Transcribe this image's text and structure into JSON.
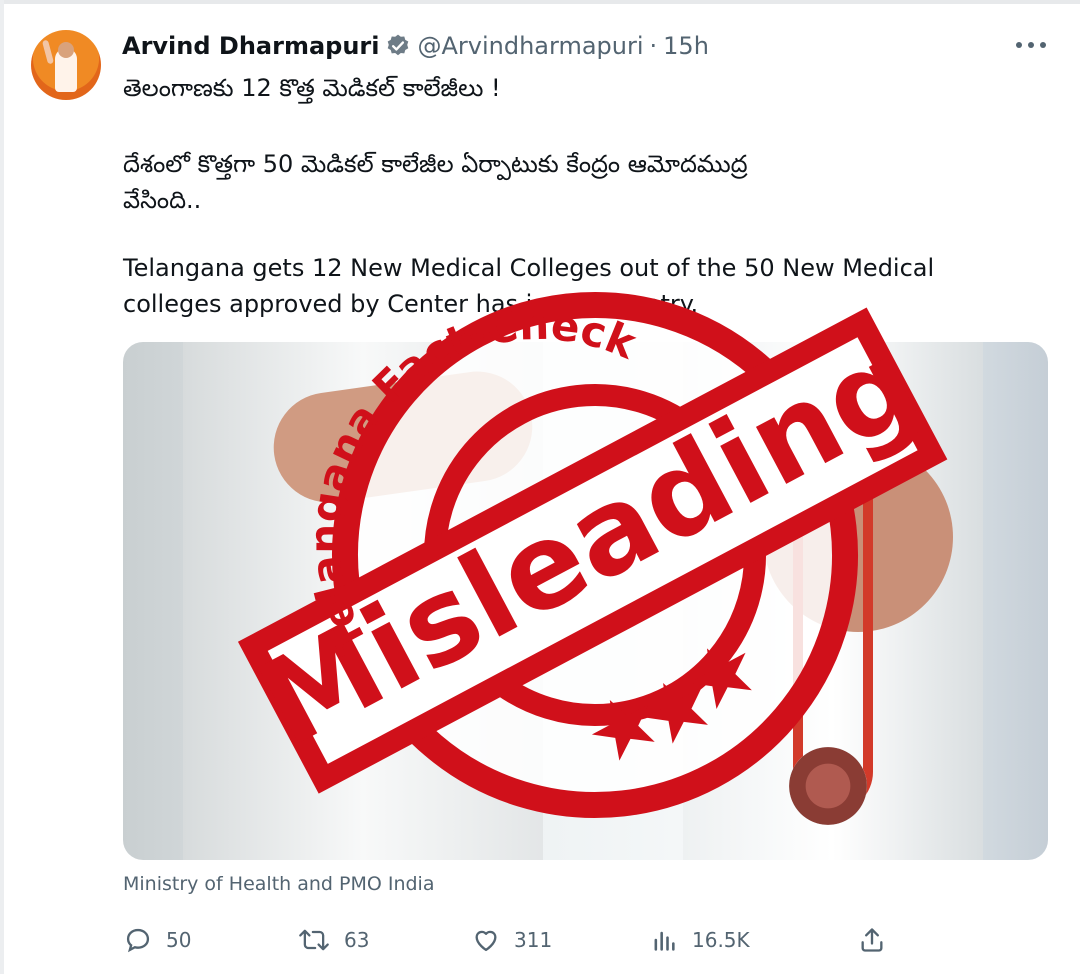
{
  "tweet": {
    "author_name": "Arvind Dharmapuri",
    "handle": "@Arvindharmapuri",
    "separator": "·",
    "time": "15h",
    "lines": [
      "తెలంగాణకు 12 కొత్త మెడికల్ కాలేజీలు !",
      "దేశంలో కొత్తగా 50 మెడికల్ కాలేజీల ఏర్పాటుకు కేంద్రం ఆమోదముద్ర",
      "వేసింది..",
      "Telangana gets 12 New Medical Colleges out of the 50 New Medical",
      "colleges approved by Center has in the country."
    ],
    "media_caption": "Ministry of Health and PMO India"
  },
  "stamp": {
    "arc_text": "Telangana Fact-Check",
    "verdict": "Misleading",
    "color": "#d0101a"
  },
  "actions": {
    "reply_count": "50",
    "retweet_count": "63",
    "like_count": "311",
    "view_count": "16.5K"
  },
  "icons": {
    "verified": "verified-badge-icon",
    "more": "more-options-icon",
    "reply": "reply-icon",
    "retweet": "retweet-icon",
    "like": "heart-icon",
    "views": "analytics-icon",
    "share": "share-icon"
  },
  "colors": {
    "text": "#0f1419",
    "secondary": "#536471",
    "verified_blue": "#1d9bf0"
  }
}
